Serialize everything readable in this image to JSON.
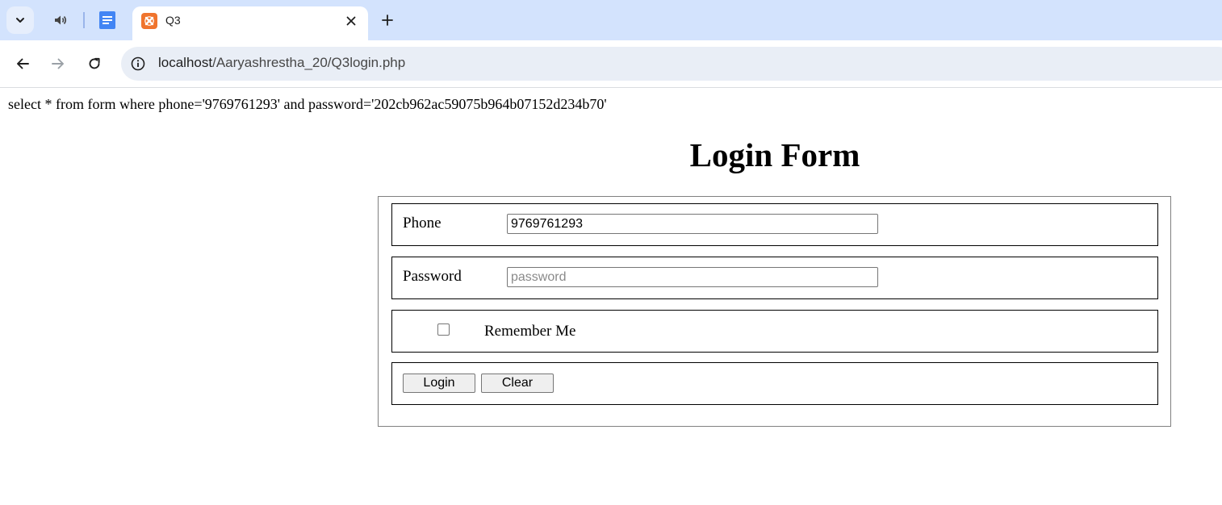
{
  "browser": {
    "tab_title": "Q3",
    "url_host": "localhost",
    "url_path": "/Aaryashrestha_20/Q3login.php",
    "accent_color": "#d3e3fd",
    "favicon_color": "#f0742d",
    "icons": [
      "chevron-down-icon",
      "speaker-icon",
      "docs-icon",
      "xampp-icon",
      "close-icon",
      "plus-icon",
      "back-arrow-icon",
      "forward-arrow-icon",
      "reload-icon",
      "info-icon"
    ]
  },
  "page": {
    "query_text": "select * from form where phone='9769761293' and password='202cb962ac59075b964b07152d234b70'",
    "heading": "Login Form",
    "form": {
      "phone_label": "Phone",
      "phone_value": "9769761293",
      "password_label": "Password",
      "password_placeholder": "password",
      "remember_label": "Remember Me",
      "remember_checked": false,
      "login_button": "Login",
      "clear_button": "Clear"
    }
  }
}
